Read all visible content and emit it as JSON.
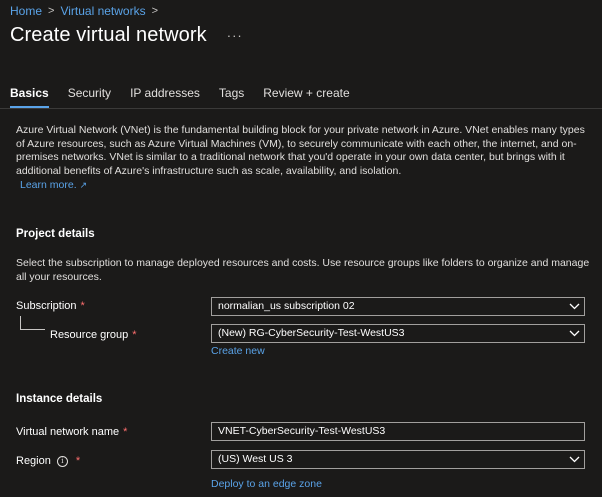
{
  "breadcrumb": {
    "home": "Home",
    "virtual_networks": "Virtual networks",
    "separator": ">"
  },
  "page": {
    "title": "Create virtual network",
    "more_label": "···"
  },
  "tabs": [
    {
      "label": "Basics",
      "active": true
    },
    {
      "label": "Security"
    },
    {
      "label": "IP addresses"
    },
    {
      "label": "Tags"
    },
    {
      "label": "Review + create"
    }
  ],
  "intro": {
    "text": "Azure Virtual Network (VNet) is the fundamental building block for your private network in Azure. VNet enables many types of Azure resources, such as Azure Virtual Machines (VM), to securely communicate with each other, the internet, and on-premises networks. VNet is similar to a traditional network that you'd operate in your own data center, but brings with it additional benefits of Azure's infrastructure such as scale, availability, and isolation.",
    "learn_more": "Learn more.",
    "learn_more_icon": "external-link-icon"
  },
  "project": {
    "title": "Project details",
    "description": "Select the subscription to manage deployed resources and costs. Use resource groups like folders to organize and manage all your resources.",
    "subscription_label": "Subscription",
    "subscription_value": "normalian_us subscription 02",
    "resource_group_label": "Resource group",
    "resource_group_value": "(New) RG-CyberSecurity-Test-WestUS3",
    "create_new": "Create new"
  },
  "instance": {
    "title": "Instance details",
    "vnet_name_label": "Virtual network name",
    "vnet_name_value": "VNET-CyberSecurity-Test-WestUS3",
    "region_label": "Region",
    "region_info_icon": "i",
    "region_value": "(US) West US 3",
    "deploy_edge": "Deploy to an edge zone"
  },
  "required_marker": "*",
  "colors": {
    "background": "#1b1a19",
    "link": "#5aa3e8",
    "required": "#ff6f6f",
    "border": "#a19f9d"
  }
}
